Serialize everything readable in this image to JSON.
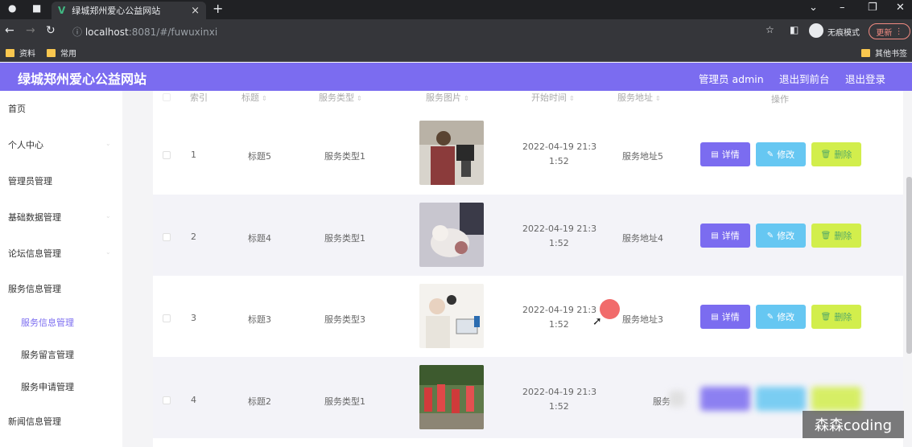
{
  "browser": {
    "tab_title": "绿城郑州爱心公益网站",
    "tab_close": "×",
    "new_tab": "+",
    "url_host": "localhost",
    "url_rest": ":8081/#/fuwuxinxi",
    "incognito_label": "无痕模式",
    "update_label": "更新",
    "bookmarks": [
      "资料",
      "常用"
    ],
    "other_bookmarks": "其他书签"
  },
  "header": {
    "site_title": "绿城郑州爱心公益网站",
    "admin_label": "管理员 admin",
    "back_to_front": "退出到前台",
    "logout": "退出登录"
  },
  "sidebar": {
    "items": [
      {
        "label": "首页"
      },
      {
        "label": "个人中心"
      },
      {
        "label": "管理员管理"
      },
      {
        "label": "基础数据管理"
      },
      {
        "label": "论坛信息管理"
      },
      {
        "label": "服务信息管理"
      },
      {
        "label": "服务信息管理"
      },
      {
        "label": "服务留言管理"
      },
      {
        "label": "服务申请管理"
      },
      {
        "label": "新闻信息管理"
      }
    ]
  },
  "table": {
    "columns": [
      "索引",
      "标题",
      "服务类型",
      "服务图片",
      "开始时间",
      "服务地址",
      "操作"
    ],
    "rows": [
      {
        "index": "1",
        "title": "标题5",
        "type": "服务类型1",
        "time1": "2022-04-19 21:3",
        "time2": "1:52",
        "address": "服务地址5"
      },
      {
        "index": "2",
        "title": "标题4",
        "type": "服务类型1",
        "time1": "2022-04-19 21:3",
        "time2": "1:52",
        "address": "服务地址4"
      },
      {
        "index": "3",
        "title": "标题3",
        "type": "服务类型3",
        "time1": "2022-04-19 21:3",
        "time2": "1:52",
        "address": "服务地址3"
      },
      {
        "index": "4",
        "title": "标题2",
        "type": "服务类型1",
        "time1": "2022-04-19 21:3",
        "time2": "1:52",
        "address": "服务"
      }
    ],
    "actions": {
      "detail": "详情",
      "edit": "修改",
      "delete": "删除"
    }
  },
  "watermark": "森森coding"
}
